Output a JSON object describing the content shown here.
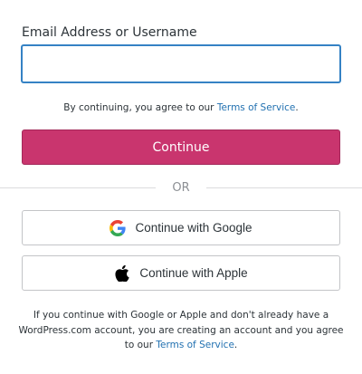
{
  "login": {
    "email_label": "Email Address or Username",
    "email_value": "",
    "tos_prefix": "By continuing, you agree to our ",
    "tos_link": "Terms of Service",
    "tos_suffix": ".",
    "continue_label": "Continue",
    "divider_text": "OR"
  },
  "social": {
    "google_label": "Continue with Google",
    "apple_label": "Continue with Apple",
    "google_icon": "google-icon",
    "apple_icon": "apple-icon"
  },
  "footer": {
    "line1": "If you continue with Google or Apple and don't already have a",
    "line2": "WordPress.com account, you are creating an account and you agree",
    "line3_prefix": "to our ",
    "line3_link": "Terms of Service",
    "line3_suffix": "."
  },
  "colors": {
    "primary": "#c9356e",
    "link": "#2271b1",
    "input_focus": "#3582c4"
  }
}
